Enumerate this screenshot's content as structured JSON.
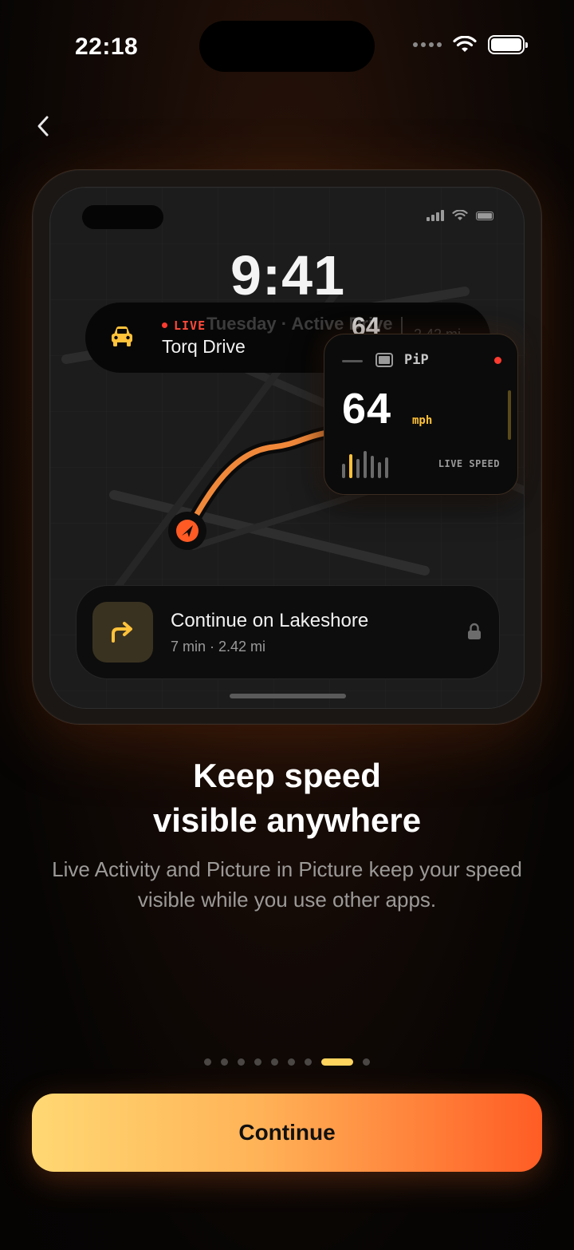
{
  "status_bar": {
    "time": "22:18"
  },
  "mockup": {
    "lock_time": "9:41",
    "live_activity": {
      "live_tag": "LIVE",
      "app_name": "Torq Drive",
      "ghost_text": "Tuesday · Active Drive",
      "ghost_speed": "64",
      "ghost_distance": "2.42 mi"
    },
    "pip": {
      "label": "PiP",
      "speed": "64",
      "unit": "mph",
      "live_label": "LIVE SPEED"
    },
    "navigation": {
      "title": "Continue on Lakeshore",
      "subtitle": "7 min · 2.42 mi"
    }
  },
  "headline": {
    "line1": "Keep speed",
    "line2": "visible anywhere"
  },
  "subtitle": "Live Activity and Picture in Picture keep your speed visible while you use other apps.",
  "pager": {
    "total": 9,
    "active_index": 7
  },
  "continue_label": "Continue",
  "colors": {
    "accent_start": "#ffd873",
    "accent_end": "#ff5c24",
    "route": "#f0883a",
    "live_red": "#ff3b30"
  }
}
